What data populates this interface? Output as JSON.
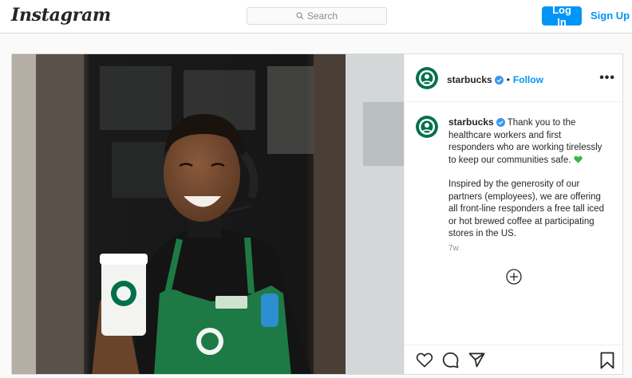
{
  "header": {
    "logo": "Instagram",
    "search_placeholder": "Search",
    "login_label": "Log In",
    "signup_label": "Sign Up"
  },
  "post": {
    "username": "starbucks",
    "follow_label": "Follow",
    "separator": "•",
    "more_label": "•••",
    "caption_paragraph_1": "Thank you to the healthcare workers and first responders who are working tirelessly to keep our communities safe.",
    "caption_emoji": "heart-green",
    "caption_paragraph_2": "Inspired by the generosity of our partners (employees), we are offering all front-line responders a free tall iced or hot brewed coffee at participating stores in the US.",
    "time_ago": "7w",
    "actions": [
      "like-icon",
      "comment-icon",
      "share-icon",
      "save-icon"
    ]
  },
  "colors": {
    "accent": "#0095f6",
    "starbucks_green": "#00704a",
    "apron_green": "#1e7a45"
  }
}
